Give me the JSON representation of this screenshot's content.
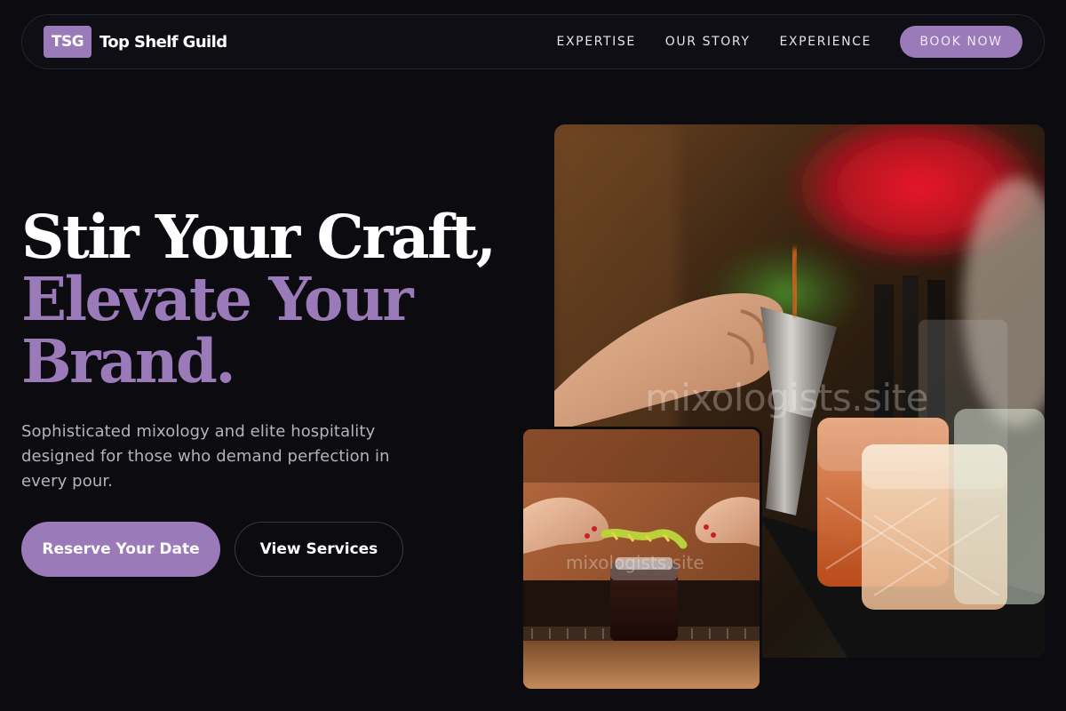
{
  "brand": {
    "logo_text": "TSG",
    "name": "Top Shelf Guild"
  },
  "nav": {
    "links": [
      "EXPERTISE",
      "OUR STORY",
      "EXPERIENCE"
    ],
    "book_label": "BOOK NOW"
  },
  "hero": {
    "headline_line1": "Stir Your Craft,",
    "headline_line2": "Elevate Your",
    "headline_line3": "Brand.",
    "subtitle": "Sophisticated mixology and elite hospitality designed for those who demand perfection in every pour.",
    "primary_cta": "Reserve Your Date",
    "secondary_cta": "View Services"
  },
  "images": {
    "main_watermark": "mixologists.site",
    "small_watermark": "mixologists.site"
  },
  "colors": {
    "background": "#0c0b10",
    "accent": "#9a7ab9",
    "text": "#ffffff",
    "muted_text": "#b5b2bd"
  }
}
